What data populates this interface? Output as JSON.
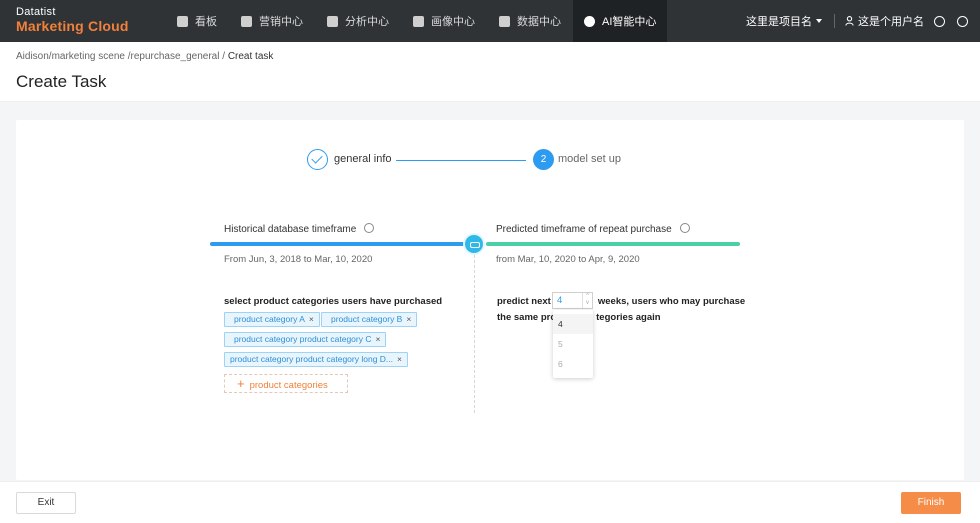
{
  "app": {
    "logo_line1": "Datatist",
    "logo_line2": "Marketing Cloud"
  },
  "nav": {
    "items": [
      {
        "label": "看板",
        "icon": "dashboard-icon"
      },
      {
        "label": "营销中心",
        "icon": "marketing-icon"
      },
      {
        "label": "分析中心",
        "icon": "analysis-icon"
      },
      {
        "label": "画像中心",
        "icon": "portrait-icon"
      },
      {
        "label": "数据中心",
        "icon": "data-icon"
      },
      {
        "label": "AI智能中心",
        "icon": "ai-icon",
        "active": true
      }
    ],
    "project": "这里是项目名",
    "username": "这是个用户名"
  },
  "breadcrumb": {
    "items": [
      "Aidison/",
      "marketing scene",
      "/repurchase_general",
      "/",
      "Creat task"
    ]
  },
  "page": {
    "title": "Create Task"
  },
  "steps": [
    {
      "label": "general info",
      "state": "done"
    },
    {
      "number": "2",
      "label": "model set up",
      "state": "current"
    }
  ],
  "historical": {
    "title": "Historical database timeframe",
    "range": "From Jun, 3, 2018 to Mar, 10, 2020",
    "select_label": "select product categories users have purchased",
    "tags": [
      "product category A",
      "product category B",
      "product category product category C",
      "product category product category long D..."
    ],
    "add_label": "product categories"
  },
  "predicted": {
    "title": "Predicted timeframe of repeat purchase",
    "range": "from Mar, 10, 2020 to Apr, 9, 2020",
    "text_before": "predict next",
    "text_after": "weeks, users who may purchase",
    "text_line2_a": "the same pro",
    "text_line2_b": "tegories again",
    "weeks_value": "4",
    "options": [
      "4",
      "5",
      "6"
    ]
  },
  "footer": {
    "exit_label": "Exit",
    "finish_label": "Finish"
  },
  "colors": {
    "topbar": "#2f3336",
    "brand_orange": "#f0803a",
    "primary_blue": "#2d9cf0",
    "green": "#4bd0a6",
    "finish": "#f58d48"
  }
}
